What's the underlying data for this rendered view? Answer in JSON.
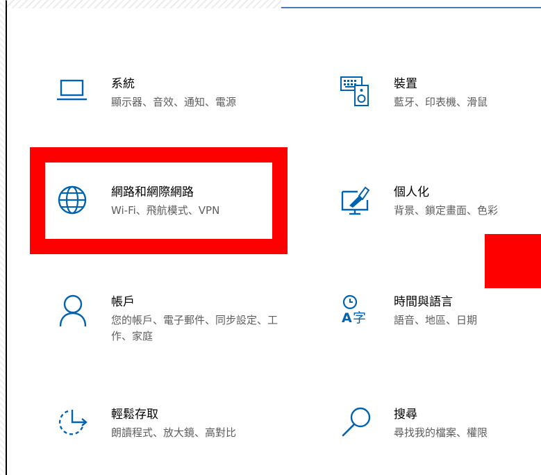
{
  "colors": {
    "accent": "#0063b1",
    "highlight": "#ff0000"
  },
  "tiles": [
    {
      "title": "系統",
      "desc": "顯示器、音效、通知、電源",
      "icon": "laptop-icon"
    },
    {
      "title": "裝置",
      "desc": "藍牙、印表機、滑鼠",
      "icon": "keyboard-speaker-icon"
    },
    {
      "title": "網路和網際網路",
      "desc": "Wi-Fi、飛航模式、VPN",
      "icon": "globe-icon"
    },
    {
      "title": "個人化",
      "desc": "背景、鎖定畫面、色彩",
      "icon": "paintbrush-monitor-icon"
    },
    {
      "title": "帳戶",
      "desc": "您的帳戶、電子郵件、同步設定、工作、家庭",
      "icon": "person-icon"
    },
    {
      "title": "時間與語言",
      "desc": "語音、地區、日期",
      "icon": "time-language-icon"
    },
    {
      "title": "輕鬆存取",
      "desc": "朗讀程式、放大鏡、高對比",
      "icon": "ease-of-access-icon"
    },
    {
      "title": "搜尋",
      "desc": "尋找我的檔案、權限",
      "icon": "search-icon"
    }
  ]
}
